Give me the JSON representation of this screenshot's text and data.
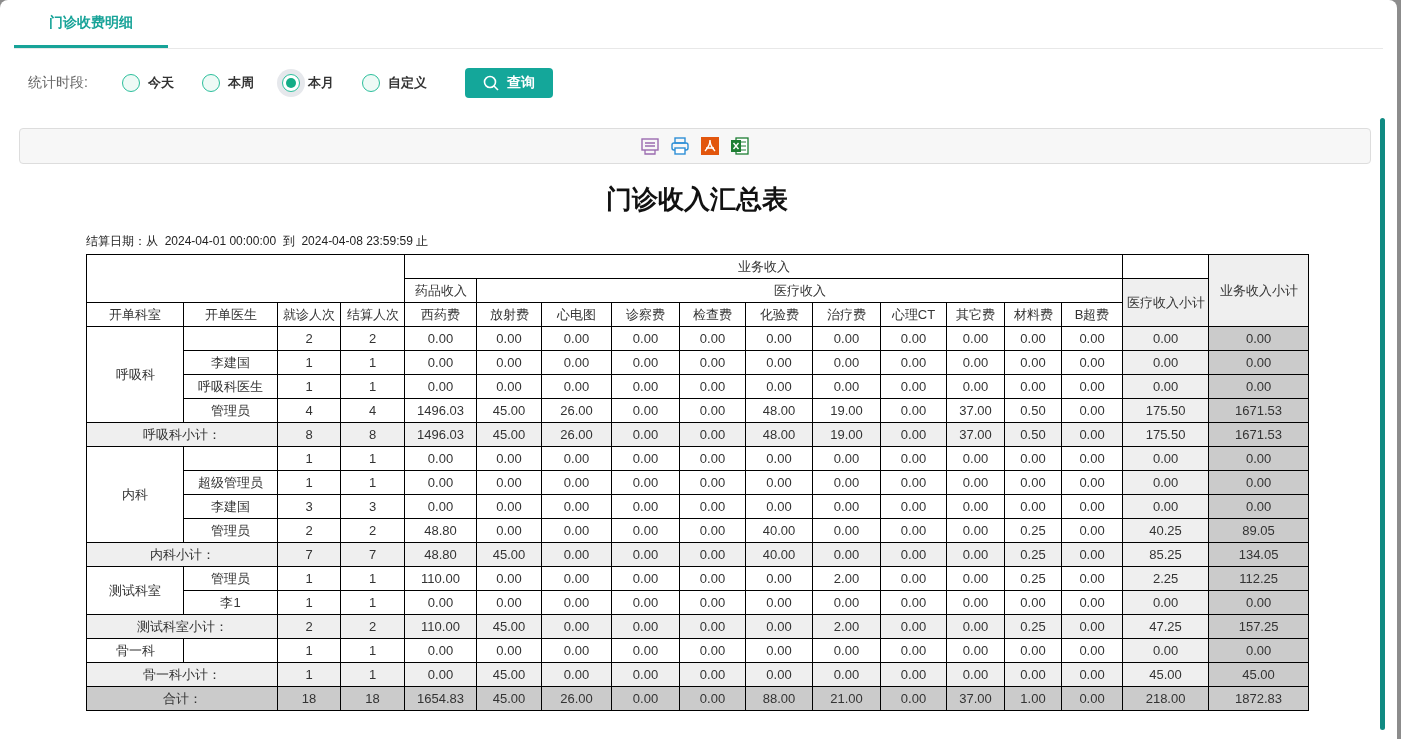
{
  "tabs": [
    {
      "label": "门诊收费明细",
      "selected": true
    }
  ],
  "filter": {
    "label": "统计时段:",
    "options": [
      {
        "label": "今天",
        "selected": false
      },
      {
        "label": "本周",
        "selected": false
      },
      {
        "label": "本月",
        "selected": true
      },
      {
        "label": "自定义",
        "selected": false
      }
    ],
    "query_button": "查询"
  },
  "report": {
    "title": "门诊收入汇总表",
    "date_range": "结算日期：从  2024-04-01 00:00:00  到  2024-04-08 23:59:59 止",
    "table": {
      "top_header": "业务收入",
      "drug_header": "药品收入",
      "medical_header": "医疗收入",
      "medical_subtotal_header": "医疗收入小计",
      "business_subtotal_header": "业务收入小计",
      "columns": [
        "开单科室",
        "开单医生",
        "就诊人次",
        "结算人次",
        "西药费",
        "放射费",
        "心电图",
        "诊察费",
        "检查费",
        "化验费",
        "治疗费",
        "心理CT",
        "其它费",
        "材料费",
        "B超费"
      ],
      "groups": [
        {
          "department": "呼吸科",
          "rows": [
            {
              "values": [
                "2",
                "2",
                "0.00",
                "0.00",
                "0.00",
                "0.00",
                "0.00",
                "0.00",
                "0.00",
                "0.00",
                "0.00",
                "0.00",
                "0.00",
                "0.00",
                "0.00"
              ]
            },
            {
              "doctor": "李建国",
              "values": [
                "1",
                "1",
                "0.00",
                "0.00",
                "0.00",
                "0.00",
                "0.00",
                "0.00",
                "0.00",
                "0.00",
                "0.00",
                "0.00",
                "0.00",
                "0.00",
                "0.00"
              ]
            },
            {
              "doctor": "呼吸科医生",
              "values": [
                "1",
                "1",
                "0.00",
                "0.00",
                "0.00",
                "0.00",
                "0.00",
                "0.00",
                "0.00",
                "0.00",
                "0.00",
                "0.00",
                "0.00",
                "0.00",
                "0.00"
              ]
            },
            {
              "doctor": "管理员",
              "values": [
                "4",
                "4",
                "1496.03",
                "45.00",
                "26.00",
                "0.00",
                "0.00",
                "48.00",
                "19.00",
                "0.00",
                "37.00",
                "0.50",
                "0.00",
                "175.50",
                "1671.53"
              ]
            }
          ],
          "subtotal": {
            "label": "呼吸科小计：",
            "values": [
              "8",
              "8",
              "1496.03",
              "45.00",
              "26.00",
              "0.00",
              "0.00",
              "48.00",
              "19.00",
              "0.00",
              "37.00",
              "0.50",
              "0.00",
              "175.50",
              "1671.53"
            ]
          }
        },
        {
          "department": "内科",
          "rows": [
            {
              "values": [
                "1",
                "1",
                "0.00",
                "0.00",
                "0.00",
                "0.00",
                "0.00",
                "0.00",
                "0.00",
                "0.00",
                "0.00",
                "0.00",
                "0.00",
                "0.00",
                "0.00"
              ]
            },
            {
              "doctor": "超级管理员",
              "values": [
                "1",
                "1",
                "0.00",
                "0.00",
                "0.00",
                "0.00",
                "0.00",
                "0.00",
                "0.00",
                "0.00",
                "0.00",
                "0.00",
                "0.00",
                "0.00",
                "0.00"
              ]
            },
            {
              "doctor": "李建国",
              "values": [
                "3",
                "3",
                "0.00",
                "0.00",
                "0.00",
                "0.00",
                "0.00",
                "0.00",
                "0.00",
                "0.00",
                "0.00",
                "0.00",
                "0.00",
                "0.00",
                "0.00"
              ]
            },
            {
              "doctor": "管理员",
              "values": [
                "2",
                "2",
                "48.80",
                "0.00",
                "0.00",
                "0.00",
                "0.00",
                "40.00",
                "0.00",
                "0.00",
                "0.00",
                "0.25",
                "0.00",
                "40.25",
                "89.05"
              ]
            }
          ],
          "subtotal": {
            "label": "内科小计：",
            "values": [
              "7",
              "7",
              "48.80",
              "45.00",
              "0.00",
              "0.00",
              "0.00",
              "40.00",
              "0.00",
              "0.00",
              "0.00",
              "0.25",
              "0.00",
              "85.25",
              "134.05"
            ]
          }
        },
        {
          "department": "测试科室",
          "rows": [
            {
              "doctor": "管理员",
              "values": [
                "1",
                "1",
                "110.00",
                "0.00",
                "0.00",
                "0.00",
                "0.00",
                "0.00",
                "2.00",
                "0.00",
                "0.00",
                "0.25",
                "0.00",
                "2.25",
                "112.25"
              ]
            },
            {
              "doctor": "李1",
              "values": [
                "1",
                "1",
                "0.00",
                "0.00",
                "0.00",
                "0.00",
                "0.00",
                "0.00",
                "0.00",
                "0.00",
                "0.00",
                "0.00",
                "0.00",
                "0.00",
                "0.00"
              ]
            }
          ],
          "subtotal": {
            "label": "测试科室小计：",
            "values": [
              "2",
              "2",
              "110.00",
              "45.00",
              "0.00",
              "0.00",
              "0.00",
              "0.00",
              "2.00",
              "0.00",
              "0.00",
              "0.25",
              "0.00",
              "47.25",
              "157.25"
            ]
          }
        },
        {
          "department": "骨一科",
          "rows": [
            {
              "values": [
                "1",
                "1",
                "0.00",
                "0.00",
                "0.00",
                "0.00",
                "0.00",
                "0.00",
                "0.00",
                "0.00",
                "0.00",
                "0.00",
                "0.00",
                "0.00",
                "0.00"
              ]
            }
          ],
          "subtotal": {
            "label": "骨一科小计：",
            "values": [
              "1",
              "1",
              "0.00",
              "45.00",
              "0.00",
              "0.00",
              "0.00",
              "0.00",
              "0.00",
              "0.00",
              "0.00",
              "0.00",
              "0.00",
              "45.00",
              "45.00"
            ]
          }
        }
      ],
      "total": {
        "label": "合计：",
        "values": [
          "18",
          "18",
          "1654.83",
          "45.00",
          "26.00",
          "0.00",
          "0.00",
          "88.00",
          "21.00",
          "0.00",
          "37.00",
          "1.00",
          "0.00",
          "218.00",
          "1872.83"
        ]
      }
    }
  }
}
